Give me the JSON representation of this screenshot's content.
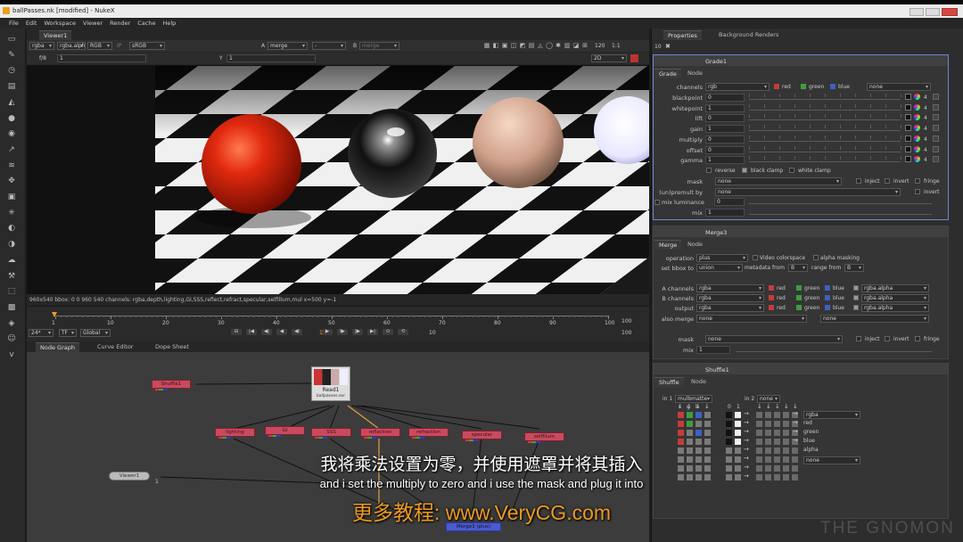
{
  "window": {
    "title": "ballPasses.nk [modified] - NukeX"
  },
  "menu": [
    "File",
    "Edit",
    "Workspace",
    "Viewer",
    "Render",
    "Cache",
    "Help"
  ],
  "viewer": {
    "tab": "Viewer1",
    "channels": "rgba",
    "alpha": "rgba.alpha",
    "colorspace_label": "RGB",
    "lut": "sRGB",
    "input_a": "A",
    "merge_mode": "merge",
    "dash": "-",
    "input_b": "B",
    "merge_b": "merge",
    "zoom": "120",
    "ratio": "1:1",
    "fstop": "f/8",
    "frame_field": "1",
    "y_label": "Y",
    "y_field": "1",
    "view_mode": "2D",
    "status": "960x540  bbox: 0 0 960 540 channels: rgba,depth,lighting,GI,SSS,reflect,refract,specular,selfillum,mul  x=500 y=-1"
  },
  "timeline": {
    "ticks": [
      "1",
      "10",
      "20",
      "30",
      "40",
      "50",
      "60",
      "70",
      "80",
      "90",
      "100"
    ],
    "end_label": "100",
    "fps": "24*",
    "tf": "TF",
    "scope": "Global",
    "current_frame": "1",
    "step": "10",
    "end_frame": "100"
  },
  "graph_tabs": [
    "Node Graph",
    "Curve Editor",
    "Dope Sheet"
  ],
  "graph": {
    "read_label": "Read1",
    "read_file": "ballpasses.exr",
    "viewer_node": "Viewer1",
    "viewer_input": "1",
    "merge_node": "Merge3 (plus)",
    "nodes": [
      "Shuffle1",
      "lighting",
      "GI",
      "SSS",
      "reflection",
      "refraction",
      "specular",
      "selfillum"
    ]
  },
  "properties": {
    "tabs": [
      "Properties",
      "Background Renders"
    ],
    "count": "10",
    "grade": {
      "title": "Grade1",
      "tabs": [
        "Grade",
        "Node"
      ],
      "channels_label": "channels",
      "channels": "rgb",
      "none": "none",
      "chk": [
        "red",
        "green",
        "blue"
      ],
      "rows": [
        {
          "label": "blackpoint",
          "value": "0"
        },
        {
          "label": "whitepoint",
          "value": "1"
        },
        {
          "label": "lift",
          "value": "0"
        },
        {
          "label": "gain",
          "value": "1"
        },
        {
          "label": "multiply",
          "value": "0"
        },
        {
          "label": "offset",
          "value": "0"
        },
        {
          "label": "gamma",
          "value": "1"
        }
      ],
      "reverse": "reverse",
      "black_clamp": "black clamp",
      "white_clamp": "white clamp",
      "mask_label": "mask",
      "mask": "none",
      "inject": "inject",
      "invert": "invert",
      "fringe": "fringe",
      "unpremult_label": "(un)premult by",
      "unpremult": "none",
      "invert2": "invert",
      "mixlum_label": "mix luminance",
      "mixlum": "0",
      "mix_label": "mix",
      "mix": "1",
      "four": "4"
    },
    "merge": {
      "title": "Merge3",
      "tabs": [
        "Merge",
        "Node"
      ],
      "operation_label": "operation",
      "operation": "plus",
      "video_cs": "Video colorspace",
      "alpha_masking": "alpha masking",
      "bbox_label": "set bbox to",
      "bbox": "union",
      "metadata_label": "metadata from",
      "metadata": "B",
      "range_label": "range from",
      "range": "B",
      "a_label": "A channels",
      "a_ch": "rgba",
      "a_alpha": "rgba.alpha",
      "b_label": "B channels",
      "b_ch": "rgba",
      "b_alpha": "rgba.alpha",
      "out_label": "output",
      "out_ch": "rgba",
      "out_alpha": "rgba.alpha",
      "also_label": "also merge",
      "also": "none",
      "also2": "none",
      "chk": [
        "red",
        "green",
        "blue"
      ],
      "mask_label": "mask",
      "mask": "none",
      "inject": "inject",
      "invert": "invert",
      "fringe": "fringe",
      "mix_label": "mix",
      "mix": "1"
    },
    "shuffle": {
      "title": "Shuffle1",
      "tabs": [
        "Shuffle",
        "Node"
      ],
      "in1_label": "in 1",
      "in1": "mulbmatte",
      "in2_label": "in 2",
      "in2": "none",
      "col_r": "r",
      "col_g": "g",
      "col_b": "b",
      "col_0": "0",
      "col_1": "1",
      "out": "rgba",
      "out2": "none",
      "outs": [
        "red",
        "green",
        "blue",
        "alpha"
      ]
    }
  },
  "subtitles": {
    "zh": "我将乘法设置为零，并使用遮罩并将其插入",
    "en": "and i set the multiply to zero and i use the mask and plug it into",
    "promo": "更多教程: www.VeryCG.com"
  },
  "watermark": "THE GNOMON",
  "colors": {
    "accent": "#f39a1e",
    "node_red": "#c94a5e",
    "panel": "#2f2f2f"
  }
}
